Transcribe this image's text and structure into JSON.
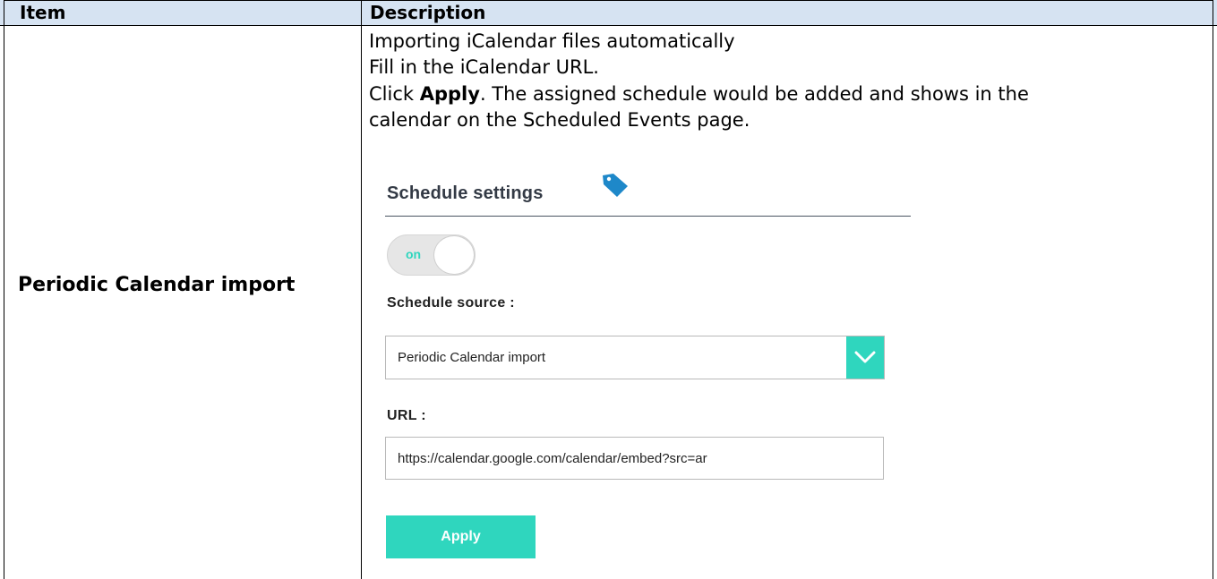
{
  "table": {
    "headers": {
      "item": "Item",
      "description": "Description"
    },
    "row": {
      "item": "Periodic Calendar import",
      "description": {
        "line1": "Importing iCalendar files automatically",
        "line2": "Fill in the iCalendar URL.",
        "line3_prefix": "Click ",
        "line3_bold": "Apply",
        "line3_suffix": ". The assigned schedule would be added and shows in the",
        "line4": "calendar on the Scheduled Events page."
      }
    }
  },
  "settings_panel": {
    "title": "Schedule settings",
    "title_icon": "tag-icon",
    "toggle": {
      "label": "on",
      "state": true
    },
    "schedule_source": {
      "label": "Schedule source :",
      "selected": "Periodic Calendar import"
    },
    "url": {
      "label": "URL :",
      "value": "https://calendar.google.com/calendar/embed?src=ar"
    },
    "apply_label": "Apply"
  },
  "colors": {
    "header_bg": "#d6e3f2",
    "accent": "#2fd6be",
    "tag_icon": "#1e88c9"
  }
}
